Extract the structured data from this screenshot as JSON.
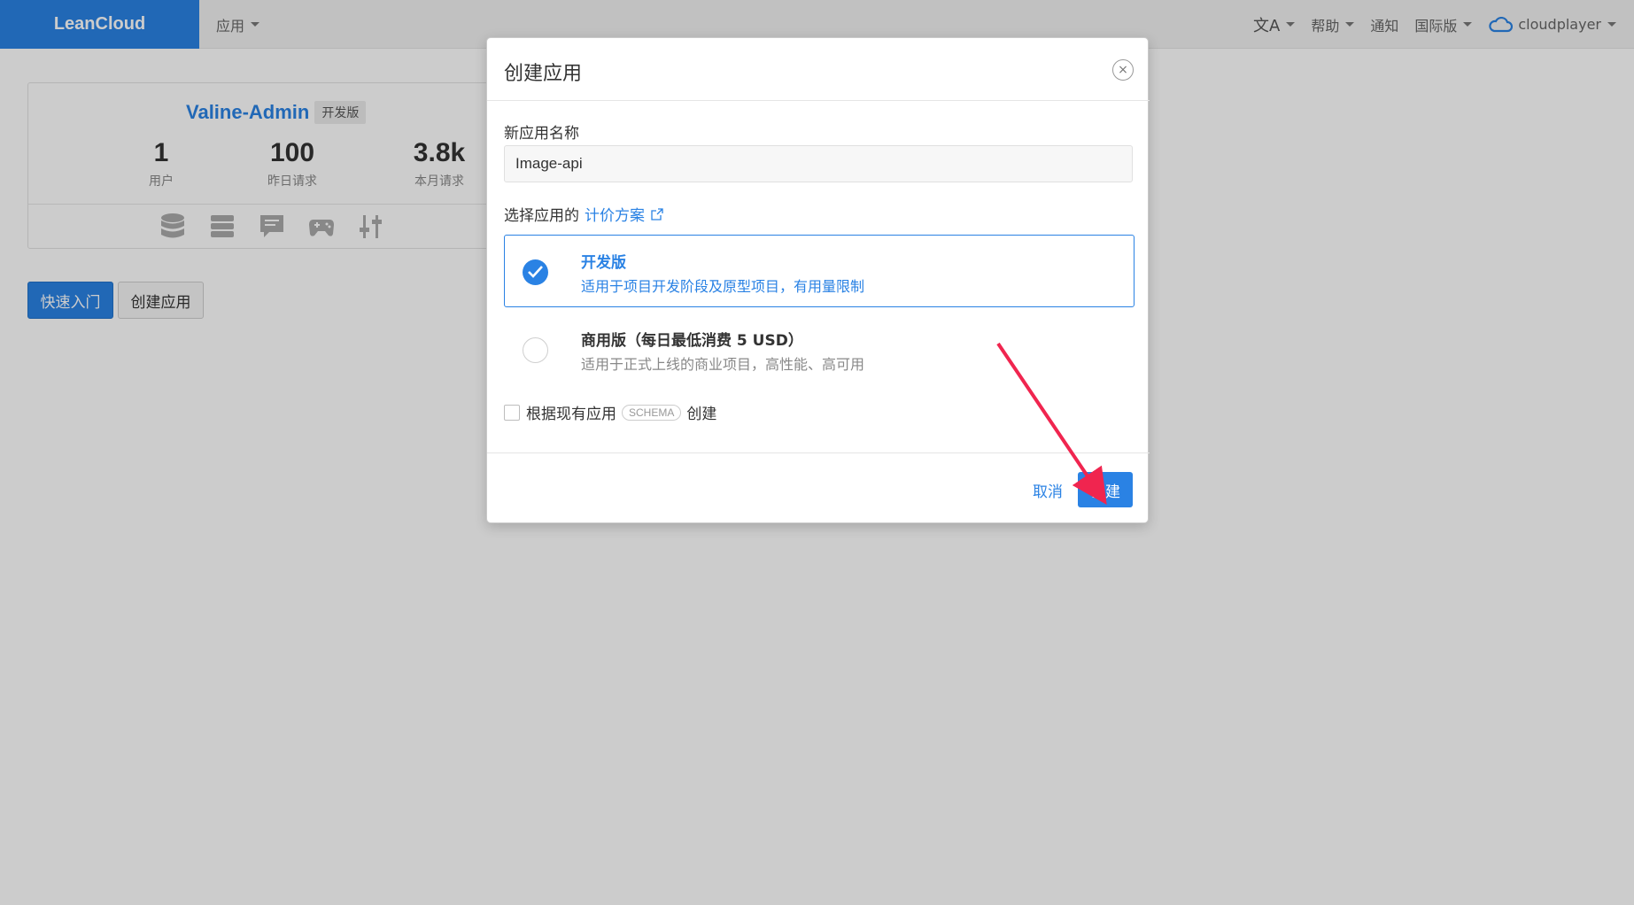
{
  "topbar": {
    "brand": "LeanCloud",
    "apps_menu": "应用",
    "help": "帮助",
    "notify": "通知",
    "region": "国际版",
    "user": "cloudplayer"
  },
  "app_card": {
    "name": "Valine-Admin",
    "tag": "开发版",
    "stats": [
      {
        "value": "1",
        "label": "用户"
      },
      {
        "value": "100",
        "label": "昨日请求"
      },
      {
        "value": "3.8k",
        "label": "本月请求"
      }
    ],
    "icons": [
      "database-icon",
      "server-icon",
      "message-icon",
      "gamepad-icon",
      "sliders-icon"
    ]
  },
  "actions": {
    "quick_start": "快速入门",
    "create_app": "创建应用"
  },
  "modal": {
    "title": "创建应用",
    "close_symbol": "×",
    "name_label": "新应用名称",
    "name_value": "Image-api",
    "plan_prefix": "选择应用的",
    "plan_link": "计价方案",
    "plans": [
      {
        "title": "开发版",
        "desc": "适用于项目开发阶段及原型项目，有用量限制",
        "selected": true
      },
      {
        "title": "商用版（每日最低消费 5 USD）",
        "desc": "适用于正式上线的商业项目，高性能、高可用",
        "selected": false
      }
    ],
    "schema_prefix": "根据现有应用",
    "schema_badge": "SCHEMA",
    "schema_suffix": "创建",
    "cancel": "取消",
    "create": "创建"
  },
  "colors": {
    "accent": "#2a82e4",
    "annotation_arrow": "#f0254f"
  }
}
